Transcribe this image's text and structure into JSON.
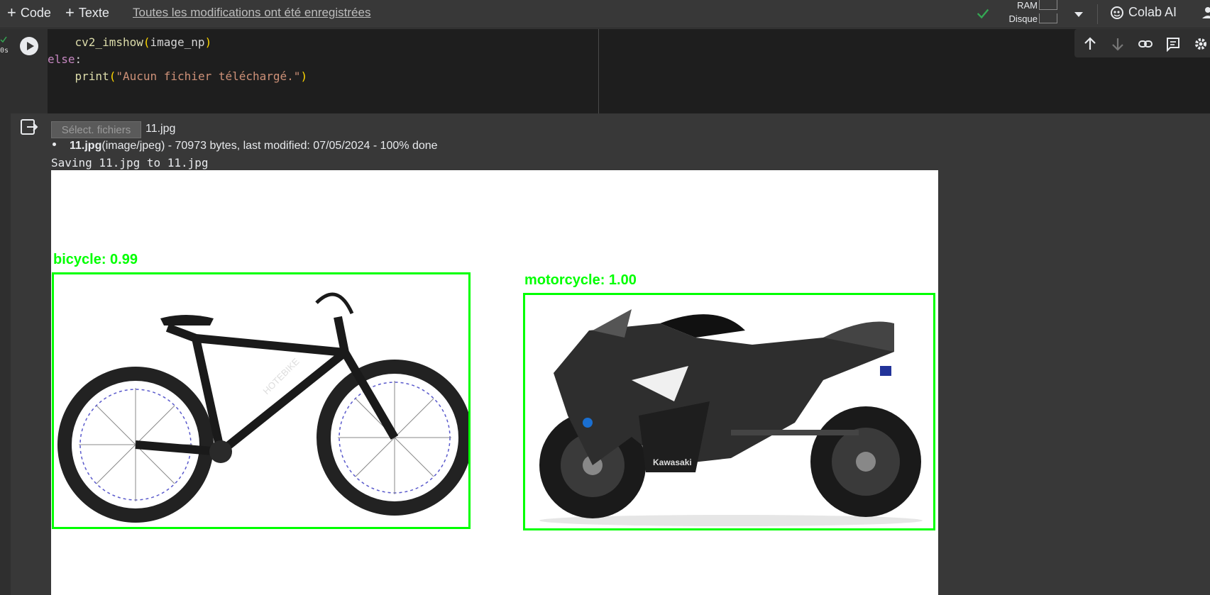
{
  "toolbar": {
    "add_code_label": "Code",
    "add_text_label": "Texte",
    "save_status": "Toutes les modifications ont été enregistrées",
    "ram_label": "RAM",
    "disk_label": "Disque",
    "colab_ai_label": "Colab AI"
  },
  "cell": {
    "exec_time": "0s",
    "code_lines": {
      "line1_indent": "    ",
      "line1_fn": "cv2_imshow",
      "line1_arg": "image_np",
      "line2_kw": "else",
      "line3_indent": "    ",
      "line3_fn": "print",
      "line3_str": "\"Aucun fichier téléchargé.\""
    }
  },
  "output": {
    "file_button_label": "Sélect. fichiers",
    "selected_file": "11.jpg",
    "file_info_name": "11.jpg",
    "file_info_rest": "(image/jpeg) - 70973 bytes, last modified: 07/05/2024 - 100% done",
    "saving_text": "Saving 11.jpg to 11.jpg",
    "detections": [
      {
        "label": "bicycle: 0.99"
      },
      {
        "label": "motorcycle: 1.00"
      }
    ],
    "bike_brand": "HOTEBIKE",
    "moto_brand": "Kawasaki"
  },
  "colors": {
    "detection_box": "#00ff00",
    "background": "#383838",
    "code_bg": "#1e1e1e"
  }
}
